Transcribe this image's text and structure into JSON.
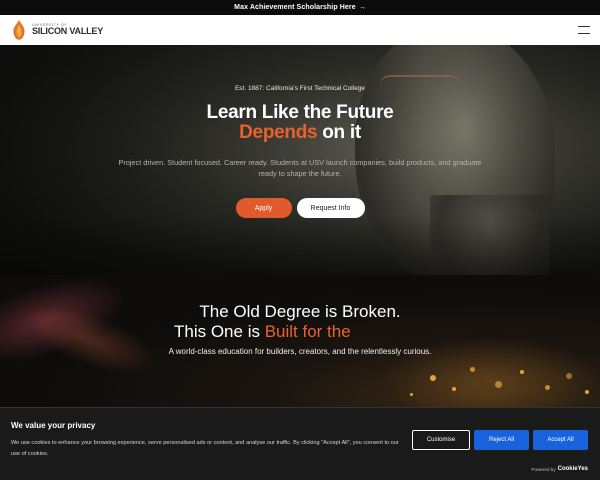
{
  "topbar": {
    "text": "Max Achievement Scholarship Here",
    "arrow": "→"
  },
  "header": {
    "logo_small": "UNIVERSITY OF",
    "logo_big": "SILICON VALLEY",
    "logo_icon": "flame-icon",
    "menu_icon": "hamburger-menu-icon"
  },
  "hero": {
    "eyebrow": "Est. 1887: California's First Technical College",
    "headline_line1": "Learn Like the Future",
    "headline_accent": "Depends",
    "headline_rest": "on it",
    "description": "Project driven. Student focused. Career ready. Students at USV launch companies, build products, and graduate ready to shape the future.",
    "apply_label": "Apply",
    "request_label": "Request Info"
  },
  "section2": {
    "headline_line1": "The Old Degree is Broken.",
    "headline_line2_plain": "This One is ",
    "headline_line2_accent": "Built for the",
    "description": "A world-class education for builders, creators, and the relentlessly curious."
  },
  "cookie": {
    "title": "We value your privacy",
    "text": "We use cookies to enhance your browsing experience, serve personalised ads or content, and analyse our traffic. By clicking \"Accept All\", you consent to our use of cookies.",
    "customise_label": "Customise",
    "reject_label": "Reject All",
    "accept_label": "Accept All",
    "powered_prefix": "Powered by",
    "powered_brand": "CookieYes"
  },
  "colors": {
    "accent": "#e05a2b",
    "cookie_button": "#1863dc",
    "dark_bg": "#111111"
  }
}
